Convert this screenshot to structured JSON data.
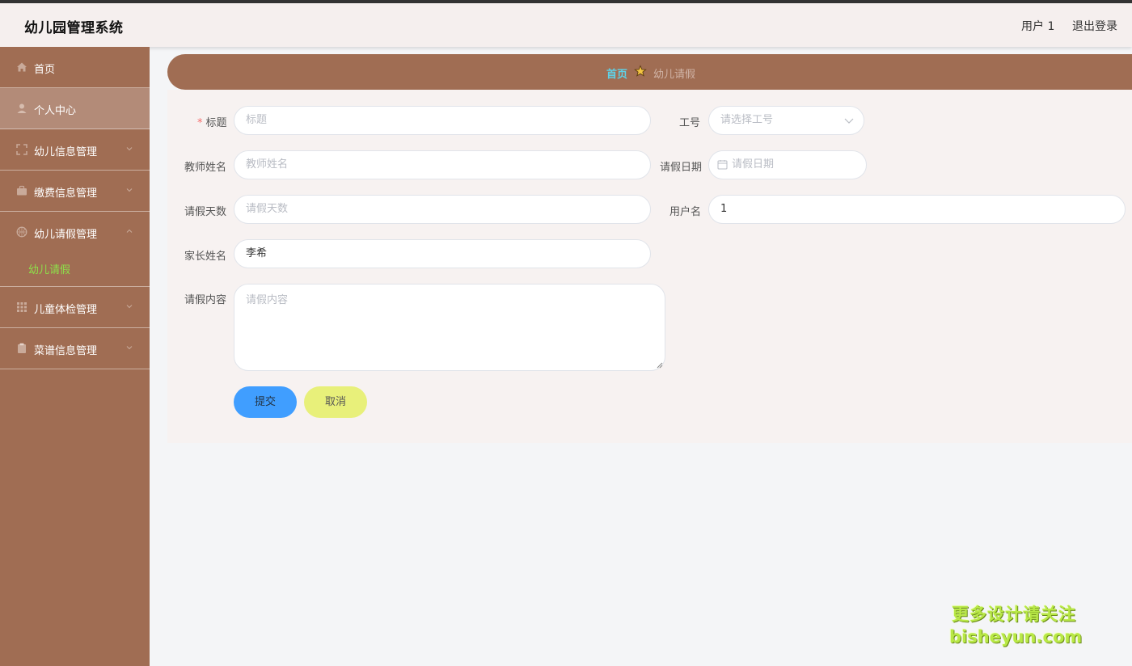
{
  "header": {
    "title": "幼儿园管理系统",
    "user": "用户 1",
    "logout": "退出登录"
  },
  "sidebar": {
    "items": [
      {
        "label": "首页",
        "icon": "home-icon"
      },
      {
        "label": "个人中心",
        "icon": "user-icon"
      },
      {
        "label": "幼儿信息管理",
        "icon": "fullscreen-icon"
      },
      {
        "label": "缴费信息管理",
        "icon": "briefcase-icon"
      },
      {
        "label": "幼儿请假管理",
        "icon": "basketball-icon"
      },
      {
        "label": "儿童体检管理",
        "icon": "grid-icon"
      },
      {
        "label": "菜谱信息管理",
        "icon": "clipboard-icon"
      }
    ],
    "submenu": {
      "label": "幼儿请假"
    }
  },
  "breadcrumb": {
    "home": "首页",
    "current": "幼儿请假"
  },
  "form": {
    "title": {
      "label": "标题",
      "placeholder": "标题"
    },
    "worker_id": {
      "label": "工号",
      "placeholder": "请选择工号"
    },
    "teacher_name": {
      "label": "教师姓名",
      "placeholder": "教师姓名"
    },
    "leave_date": {
      "label": "请假日期",
      "placeholder": "请假日期"
    },
    "leave_days": {
      "label": "请假天数",
      "placeholder": "请假天数"
    },
    "username": {
      "label": "用户名",
      "value": "1"
    },
    "parent_name": {
      "label": "家长姓名",
      "value": "李希"
    },
    "content": {
      "label": "请假内容",
      "placeholder": "请假内容"
    },
    "submit": "提交",
    "cancel": "取消"
  },
  "watermark": {
    "line1": "更多设计请关注",
    "line2": "bisheyun.com"
  },
  "colors": {
    "sidebar": "#a06d53",
    "active": "#b38b78",
    "submenu_text": "#8de04a",
    "breadcrumb_home": "#5ed2e8",
    "submit": "#409eff",
    "cancel": "#e8f07a"
  }
}
